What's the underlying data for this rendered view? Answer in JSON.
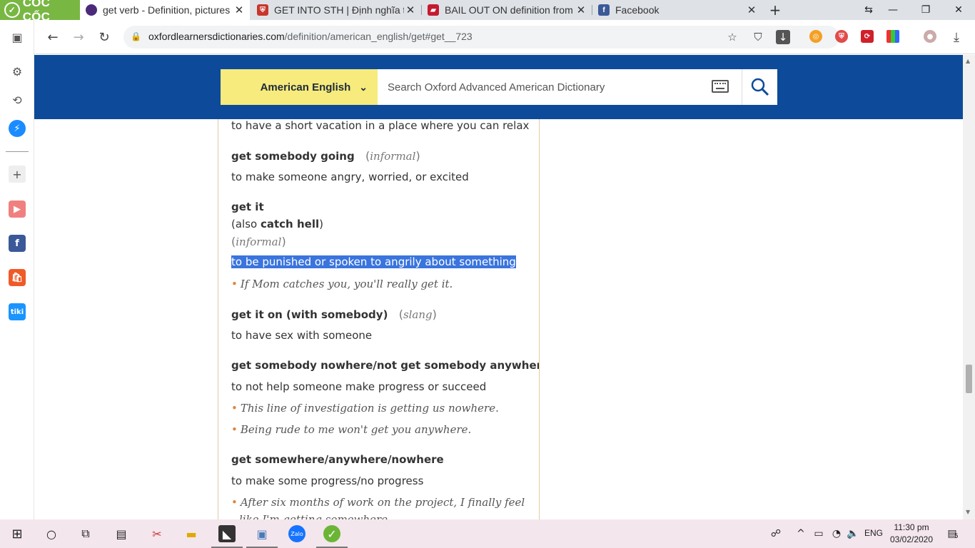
{
  "browser": {
    "brand": "CỐC CỐC",
    "tabs": [
      {
        "title": "get verb - Definition, pictures",
        "active": true
      },
      {
        "title": "GET INTO STH | Định nghĩa tr",
        "active": false
      },
      {
        "title": "BAIL OUT ON definition from",
        "active": false
      },
      {
        "title": "Facebook",
        "active": false
      }
    ],
    "url_host": "oxfordlearnersdictionaries.com",
    "url_path": "/definition/american_english/get#get__723"
  },
  "site": {
    "language": "American English",
    "search_placeholder": "Search Oxford Advanced American Dictionary"
  },
  "content": {
    "top_def": "to have a short vacation in a place where you can relax",
    "entries": [
      {
        "hw": "get somebody going",
        "label": "informal",
        "def": "to make someone angry, worried, or excited"
      },
      {
        "hw": "get it",
        "also_prefix": "(also ",
        "also_hw": "catch hell",
        "also_suffix": ")",
        "label": "informal",
        "def": "to be punished or spoken to angrily about something",
        "ex": [
          "If Mom catches you, you'll really get it."
        ]
      },
      {
        "hw": "get it on (with somebody)",
        "label": "slang",
        "def": "to have sex with someone"
      },
      {
        "hw": "get somebody nowhere/not get somebody anywhere",
        "def": "to not help someone make progress or succeed",
        "ex": [
          "This line of investigation is getting us nowhere.",
          "Being rude to me won't get you anywhere."
        ]
      },
      {
        "hw": "get somewhere/anywhere/nowhere",
        "def": "to make some progress/no progress",
        "ex": [
          "After six months of work on the project, I finally feel",
          "like I'm getting somewhere."
        ]
      }
    ]
  },
  "taskbar": {
    "lang": "ENG",
    "time": "11:30 pm",
    "date": "03/02/2020",
    "notif_count": "5"
  }
}
